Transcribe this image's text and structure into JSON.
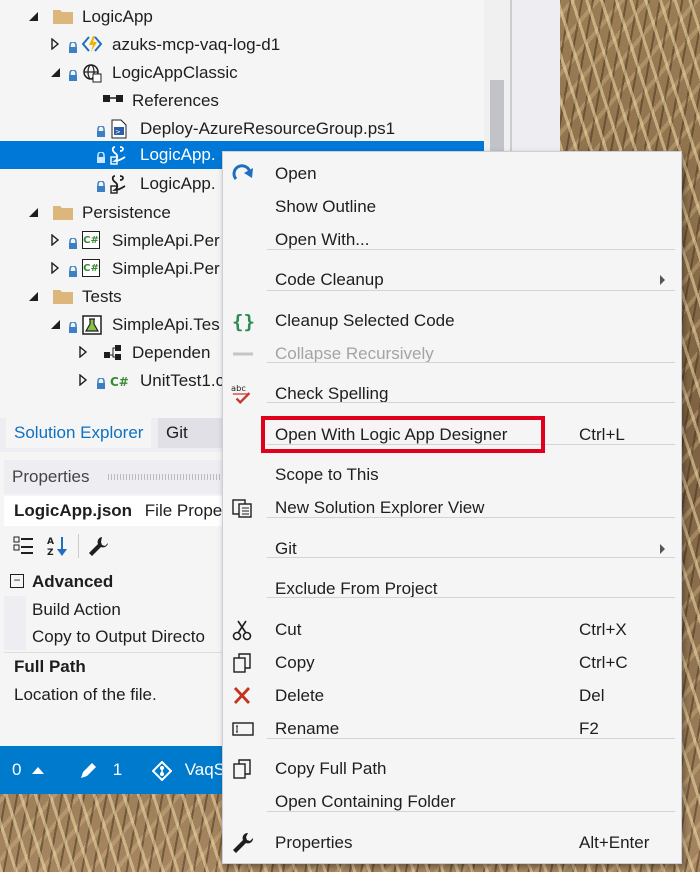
{
  "solution_explorer": {
    "tree": [
      {
        "label": "LogicApp",
        "indent": 0,
        "expander": "expanded",
        "icon": "folder-icon"
      },
      {
        "label": "azuks-mcp-vaq-log-d1",
        "indent": 1,
        "expander": "collapsed",
        "icon": "logic-app-project-icon"
      },
      {
        "label": "LogicAppClassic",
        "indent": 1,
        "expander": "expanded",
        "icon": "deployment-project-icon"
      },
      {
        "label": "References",
        "indent": 2,
        "expander": "none",
        "icon": "references-icon"
      },
      {
        "label": "Deploy-AzureResourceGroup.ps1",
        "indent": 2,
        "expander": "none",
        "icon": "powershell-file-icon"
      },
      {
        "label": "LogicApp.",
        "indent": 2,
        "expander": "none",
        "icon": "json-file-icon",
        "selected": true
      },
      {
        "label": "LogicApp.",
        "indent": 2,
        "expander": "none",
        "icon": "json-file-icon"
      },
      {
        "label": "Persistence",
        "indent": 0,
        "expander": "expanded",
        "icon": "folder-icon"
      },
      {
        "label": "SimpleApi.Per",
        "indent": 1,
        "expander": "collapsed",
        "icon": "csharp-project-icon"
      },
      {
        "label": "SimpleApi.Per",
        "indent": 1,
        "expander": "collapsed",
        "icon": "csharp-project-icon"
      },
      {
        "label": "Tests",
        "indent": 0,
        "expander": "expanded",
        "icon": "folder-icon"
      },
      {
        "label": "SimpleApi.Tes",
        "indent": 1,
        "expander": "expanded",
        "icon": "test-project-icon"
      },
      {
        "label": "Dependen",
        "indent": 2,
        "expander": "collapsed",
        "icon": "dependencies-icon"
      },
      {
        "label": "UnitTest1.c",
        "indent": 2,
        "expander": "collapsed",
        "icon": "csharp-file-icon"
      }
    ]
  },
  "tabs": [
    {
      "label": "Solution Explorer",
      "active": true
    },
    {
      "label": "Git Cha",
      "active": false
    }
  ],
  "properties": {
    "header": "Properties",
    "object_name": "LogicApp.json",
    "object_type": "File Prope",
    "category": "Advanced",
    "rows": [
      "Build Action",
      "Copy to Output Directo"
    ],
    "description_title": "Full Path",
    "description_text": "Location of the file."
  },
  "status_bar": {
    "errors": "0",
    "pending_changes": "1",
    "repo": "VaqS"
  },
  "context_menu": {
    "items": [
      {
        "label": "Open",
        "shortcut": "",
        "icon": "open-arrow-icon",
        "submenu": false,
        "disabled": false
      },
      {
        "label": "Show Outline",
        "shortcut": "",
        "icon": "",
        "submenu": false,
        "disabled": false
      },
      {
        "label": "Open With...",
        "shortcut": "",
        "icon": "",
        "submenu": false,
        "disabled": false,
        "sep_after": true
      },
      {
        "label": "Code Cleanup",
        "shortcut": "",
        "icon": "",
        "submenu": true,
        "disabled": false,
        "sep_after": true
      },
      {
        "label": "Cleanup Selected Code",
        "shortcut": "",
        "icon": "braces-icon",
        "submenu": false,
        "disabled": false
      },
      {
        "label": "Collapse Recursively",
        "shortcut": "",
        "icon": "collapse-icon",
        "submenu": false,
        "disabled": true,
        "sep_after": true
      },
      {
        "label": "Check Spelling",
        "shortcut": "",
        "icon": "spellcheck-icon",
        "submenu": false,
        "disabled": false,
        "sep_after": true
      },
      {
        "label": "Open With Logic App Designer",
        "shortcut": "Ctrl+L",
        "icon": "",
        "submenu": false,
        "disabled": false,
        "highlighted": true,
        "sep_after": true
      },
      {
        "label": "Scope to This",
        "shortcut": "",
        "icon": "",
        "submenu": false,
        "disabled": false
      },
      {
        "label": "New Solution Explorer View",
        "shortcut": "",
        "icon": "new-view-icon",
        "submenu": false,
        "disabled": false,
        "sep_after": true
      },
      {
        "label": "Git",
        "shortcut": "",
        "icon": "",
        "submenu": true,
        "disabled": false,
        "sep_after": true
      },
      {
        "label": "Exclude From Project",
        "shortcut": "",
        "icon": "",
        "submenu": false,
        "disabled": false,
        "sep_after": true
      },
      {
        "label": "Cut",
        "shortcut": "Ctrl+X",
        "icon": "scissors-icon",
        "submenu": false,
        "disabled": false
      },
      {
        "label": "Copy",
        "shortcut": "Ctrl+C",
        "icon": "copy-icon",
        "submenu": false,
        "disabled": false
      },
      {
        "label": "Delete",
        "shortcut": "Del",
        "icon": "delete-x-icon",
        "submenu": false,
        "disabled": false
      },
      {
        "label": "Rename",
        "shortcut": "F2",
        "icon": "rename-icon",
        "submenu": false,
        "disabled": false,
        "sep_after": true
      },
      {
        "label": "Copy Full Path",
        "shortcut": "",
        "icon": "copy-path-icon",
        "submenu": false,
        "disabled": false
      },
      {
        "label": "Open Containing Folder",
        "shortcut": "",
        "icon": "",
        "submenu": false,
        "disabled": false,
        "sep_after": true
      },
      {
        "label": "Properties",
        "shortcut": "Alt+Enter",
        "icon": "wrench-icon",
        "submenu": false,
        "disabled": false
      }
    ]
  },
  "colors": {
    "accent": "#007acc",
    "selection": "#0078d7",
    "highlight_box": "#e0001b",
    "active_tab_text": "#0e70c0"
  }
}
